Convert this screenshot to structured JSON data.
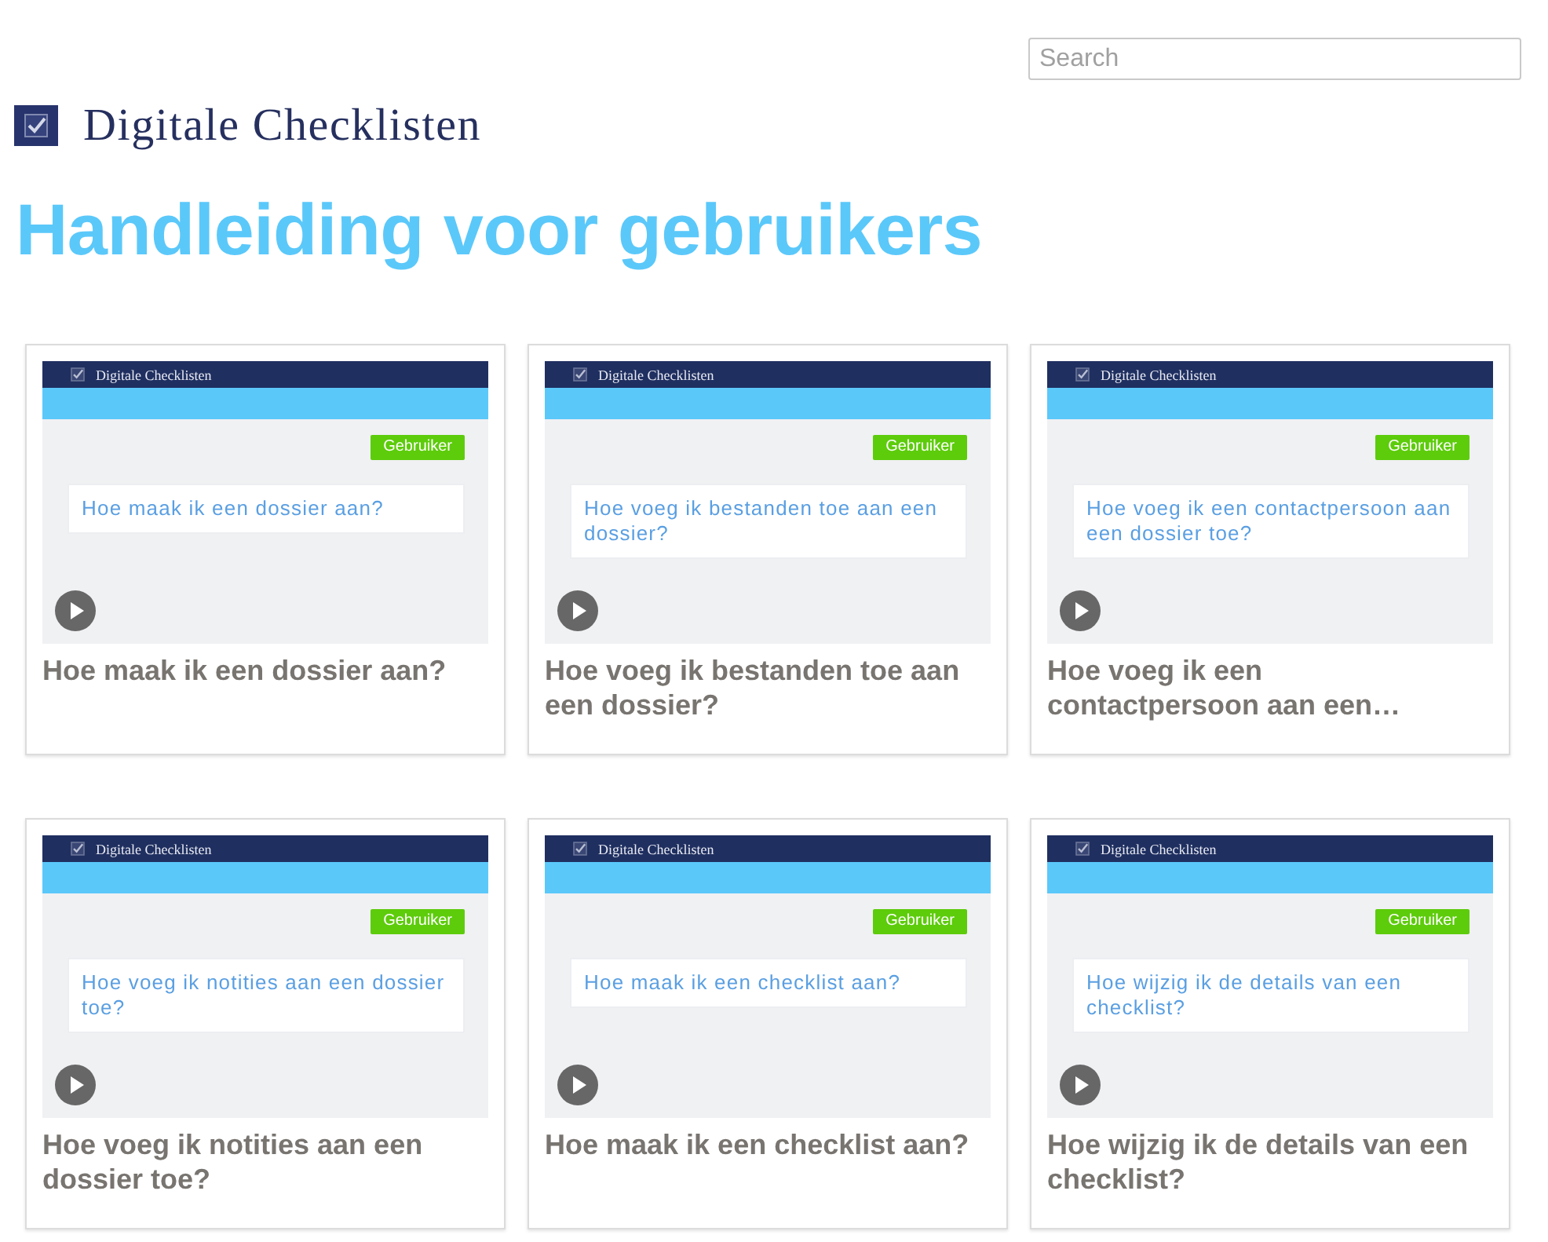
{
  "search": {
    "placeholder": "Search"
  },
  "brand": {
    "name": "Digitale Checklisten"
  },
  "heading": "Handleiding voor gebruikers",
  "videos": [
    {
      "thumbnail": {
        "app_name": "Digitale Checklisten",
        "badge": "Gebruiker",
        "question": "Hoe maak ik een dossier aan?"
      },
      "title": "Hoe maak ik een dossier aan?"
    },
    {
      "thumbnail": {
        "app_name": "Digitale Checklisten",
        "badge": "Gebruiker",
        "question": "Hoe voeg ik bestanden toe aan een dossier?"
      },
      "title": "Hoe voeg ik bestanden toe aan een dossier?"
    },
    {
      "thumbnail": {
        "app_name": "Digitale Checklisten",
        "badge": "Gebruiker",
        "question": "Hoe voeg ik een contactpersoon aan een dossier toe?"
      },
      "title": "Hoe voeg ik een contactpersoon aan een…"
    },
    {
      "thumbnail": {
        "app_name": "Digitale Checklisten",
        "badge": "Gebruiker",
        "question": "Hoe voeg ik notities aan een dossier toe?"
      },
      "title": "Hoe voeg ik notities aan een dossier toe?"
    },
    {
      "thumbnail": {
        "app_name": "Digitale Checklisten",
        "badge": "Gebruiker",
        "question": "Hoe maak ik een checklist aan?"
      },
      "title": "Hoe maak ik een checklist aan?"
    },
    {
      "thumbnail": {
        "app_name": "Digitale Checklisten",
        "badge": "Gebruiker",
        "question": "Hoe wijzig ik de details van een checklist?"
      },
      "title": "Hoe wijzig ik de details van een checklist?"
    }
  ]
}
